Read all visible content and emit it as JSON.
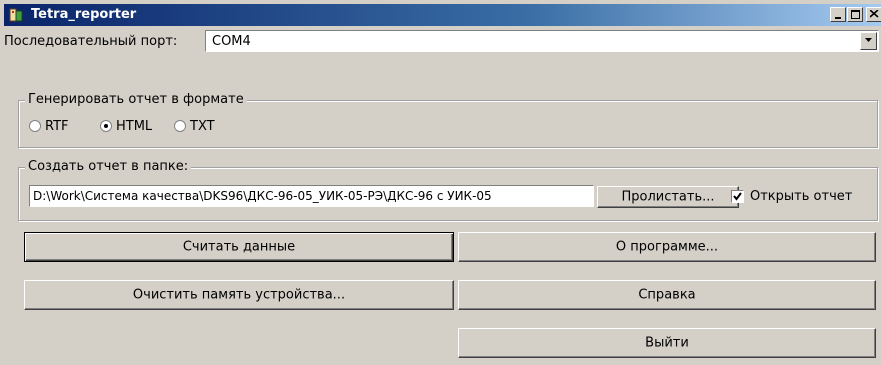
{
  "window": {
    "title": "Tetra_reporter",
    "icon": "app-icon",
    "controls": [
      "minimize-icon",
      "maximize-icon",
      "close-icon"
    ]
  },
  "port": {
    "label": "Последовательный порт:",
    "value": "COM4"
  },
  "format_group": {
    "legend": "Генерировать отчет в формате",
    "options": [
      {
        "label": "RTF",
        "selected": false
      },
      {
        "label": "HTML",
        "selected": true
      },
      {
        "label": "TXT",
        "selected": false
      }
    ]
  },
  "folder_group": {
    "legend": "Создать отчет в папке:",
    "path": "D:\\Work\\Система качества\\DKS96\\ДКС-96-05_УИК-05-РЭ\\ДКС-96 с УИК-05",
    "browse_label": "Пролистать...",
    "open_report_label": "Открыть отчет",
    "open_report_checked": true
  },
  "buttons": {
    "read_data": "Считать данные",
    "about": "О программе...",
    "clear_memory": "Очистить память устройства...",
    "help": "Справка",
    "exit": "Выйти"
  },
  "colors": {
    "face": "#d4d0c8",
    "title_gradient_start": "#0a246a",
    "title_gradient_end": "#a6caf0"
  }
}
